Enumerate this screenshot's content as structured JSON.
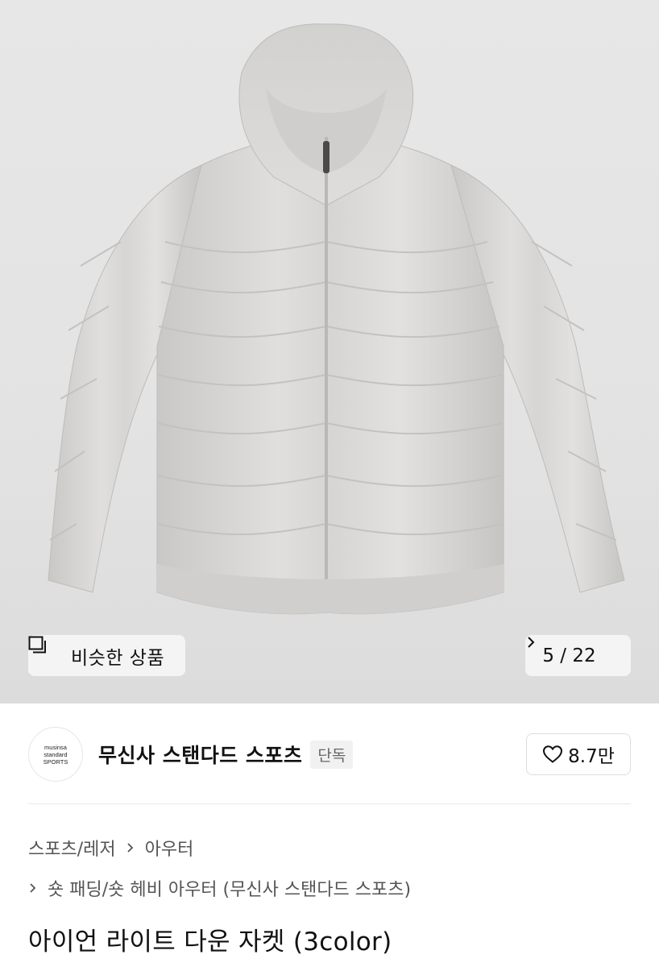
{
  "gallery": {
    "similar_label": "비슷한 상품",
    "pager_text": "5 / 22"
  },
  "brand": {
    "logo_lines": [
      "musinsa",
      "standard",
      "SPORTS"
    ],
    "name": "무신사 스탠다드 스포츠",
    "badge": "단독",
    "like_count": "8.7만"
  },
  "breadcrumb": {
    "level1": "스포츠/레저",
    "level2": "아우터",
    "level3": "숏 패딩/숏 헤비 아우터 (무신사 스탠다드 스포츠)"
  },
  "product": {
    "title": "아이언 라이트 다운 자켓 (3color)"
  },
  "colors": {
    "jacket": "#d9d8d6",
    "background": "#e5e5e5"
  }
}
